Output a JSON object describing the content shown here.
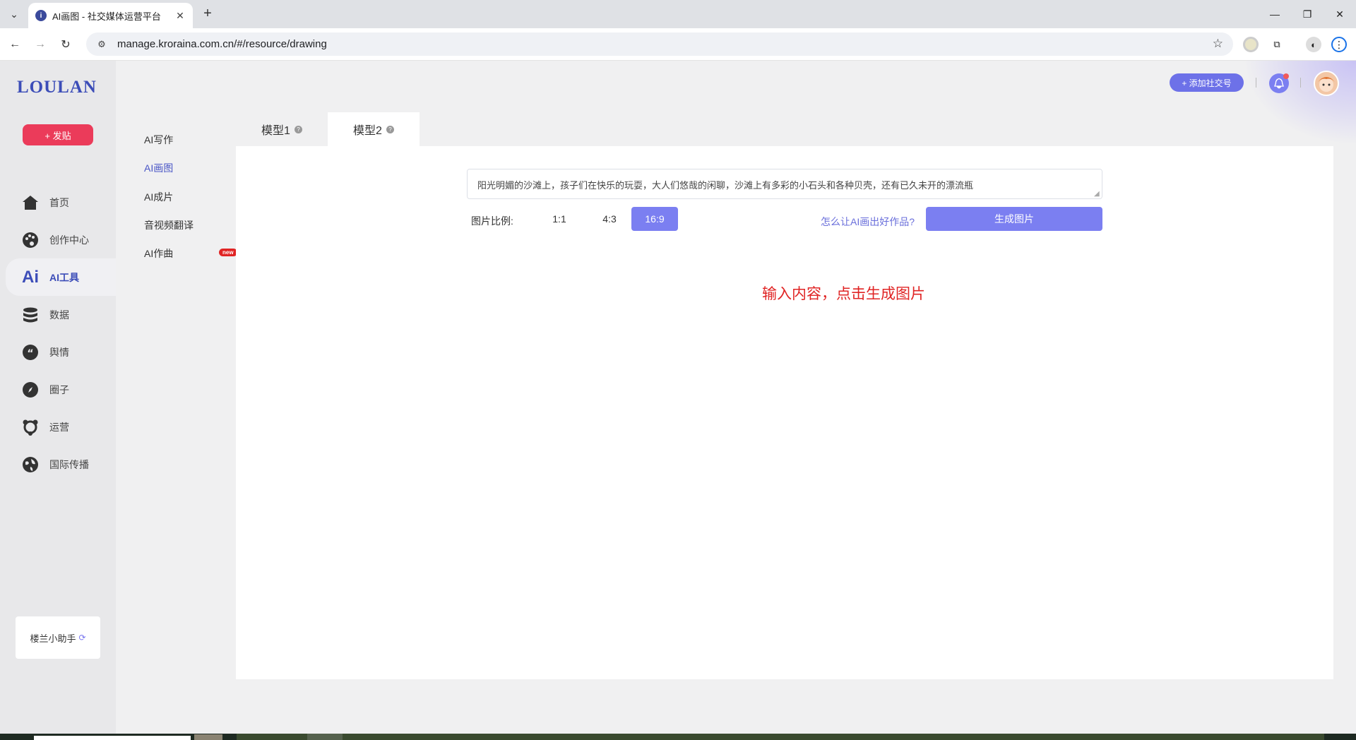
{
  "browser": {
    "tab_title": "AI画图 - 社交媒体运营平台",
    "url": "manage.kroraina.com.cn/#/resource/drawing"
  },
  "app": {
    "logo": "LOULAN",
    "post_button": "+ 发贴",
    "nav": [
      {
        "label": "首页",
        "icon": "home-icon"
      },
      {
        "label": "创作中心",
        "icon": "palette-icon"
      },
      {
        "label": "AI工具",
        "icon": "ai-icon",
        "active": true
      },
      {
        "label": "数据",
        "icon": "database-icon"
      },
      {
        "label": "舆情",
        "icon": "quote-icon"
      },
      {
        "label": "圈子",
        "icon": "compass-icon"
      },
      {
        "label": "运营",
        "icon": "network-icon"
      },
      {
        "label": "国际传播",
        "icon": "globe-icon"
      }
    ],
    "helper": "楼兰小助手",
    "subnav": [
      {
        "label": "AI写作"
      },
      {
        "label": "AI画图",
        "active": true
      },
      {
        "label": "AI成片"
      },
      {
        "label": "音视频翻译"
      },
      {
        "label": "AI作曲",
        "badge": "new"
      }
    ],
    "header": {
      "add_social": "+ 添加社交号"
    },
    "model_tabs": [
      {
        "label": "模型1"
      },
      {
        "label": "模型2",
        "active": true
      }
    ],
    "prompt_text": "阳光明媚的沙滩上，孩子们在快乐的玩耍，大人们悠哉的闲聊，沙滩上有多彩的小石头和各种贝壳，还有已久未开的漂流瓶",
    "ratio_label": "图片比例:",
    "ratios": [
      {
        "label": "1:1"
      },
      {
        "label": "4:3"
      },
      {
        "label": "16:9",
        "active": true
      }
    ],
    "howto_link": "怎么让AI画出好作品?",
    "generate_button": "生成图片",
    "hint": "输入内容，点击生成图片"
  },
  "colors": {
    "accent": "#7b7ff1",
    "brand": "#3c4db8",
    "post": "#eb3b5a",
    "hint": "#e02424"
  }
}
